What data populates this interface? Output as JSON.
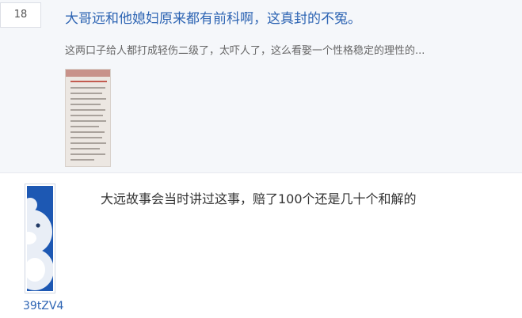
{
  "thread": {
    "reply_count": "18",
    "title": "大哥远和他媳妇原来都有前科啊，这真封的不冤。",
    "abstract": "这两口子给人都打成轻伤二级了，太吓人了，这么看娶一个性格稳定的理性的..."
  },
  "reply": {
    "content": "大远故事会当时讲过这事，赔了100个还是几十个和解的",
    "username": "39tZV4"
  },
  "colors": {
    "link": "#2d64b3",
    "avatar_bg": "#1d58b3",
    "thread_bg": "#f5f7fa"
  },
  "icons": {
    "avatar": "bear-avatar-icon",
    "thumbnail": "document-thumbnail"
  }
}
